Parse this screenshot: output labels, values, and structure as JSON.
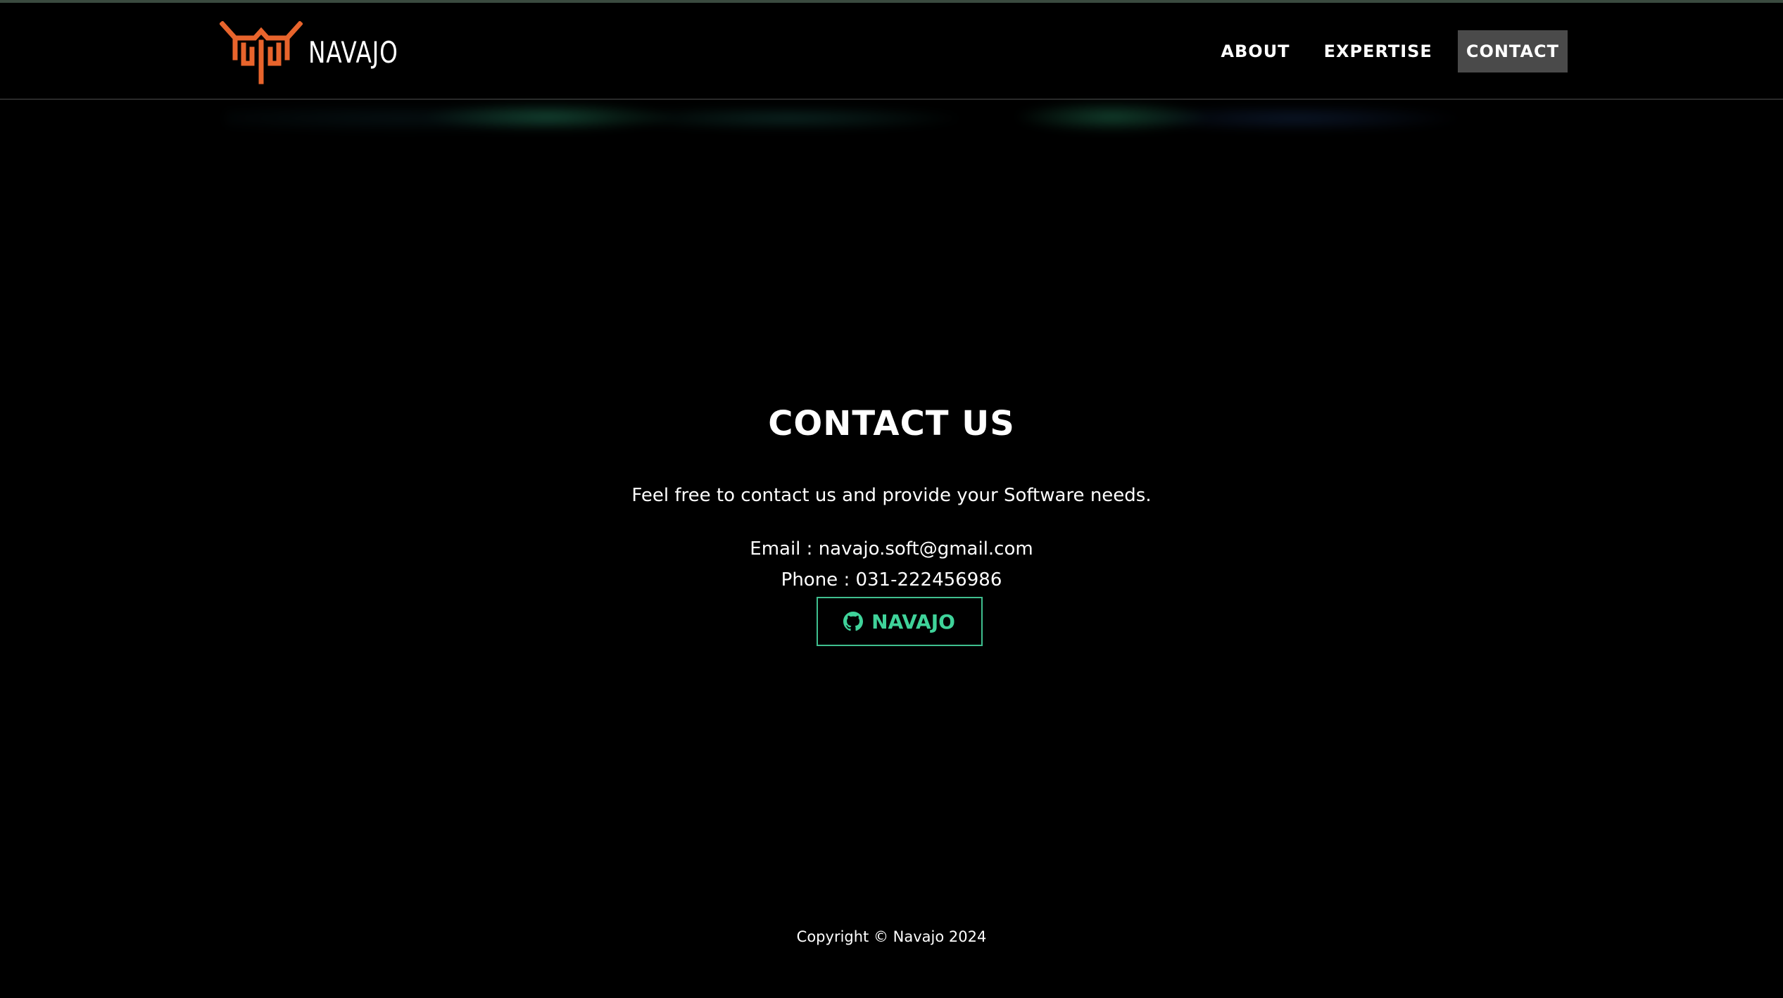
{
  "brand": {
    "name": "NAVAJO",
    "logo_color": "#e8642c"
  },
  "nav": {
    "items": [
      {
        "label": "ABOUT",
        "active": false
      },
      {
        "label": "EXPERTISE",
        "active": false
      },
      {
        "label": "CONTACT",
        "active": true
      }
    ]
  },
  "contact": {
    "title": "CONTACT US",
    "description": "Feel free to contact us and provide your Software needs.",
    "email_line": "Email : navajo.soft@gmail.com",
    "phone_line": "Phone : 031-222456986",
    "github_label": "NAVAJO",
    "github_icon": "github-icon",
    "accent_color": "#3fd39a"
  },
  "footer": {
    "copyright": "Copyright © Navajo 2024"
  }
}
